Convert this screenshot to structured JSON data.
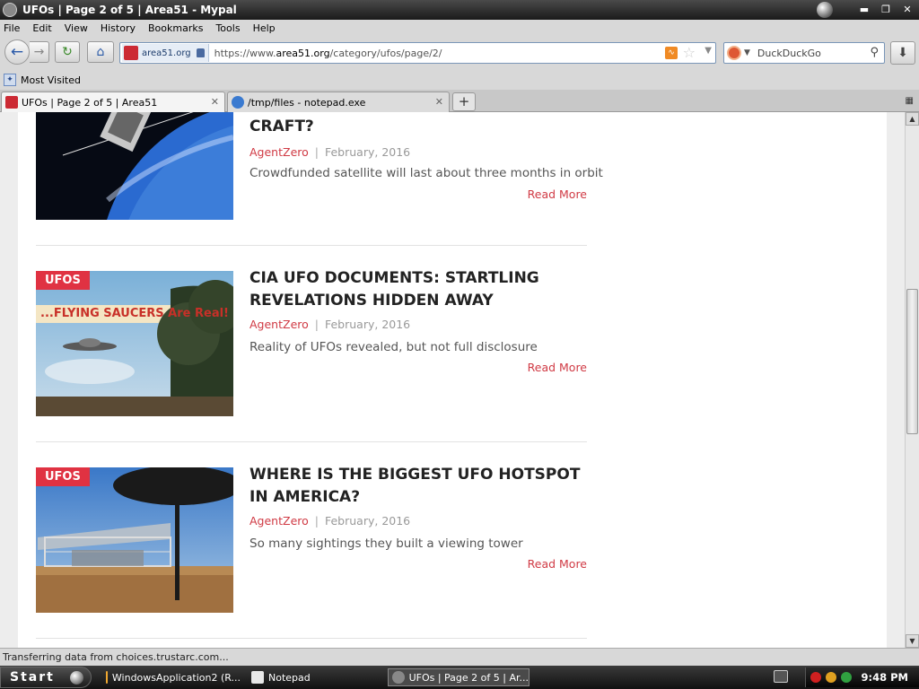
{
  "window": {
    "title": "UFOs | Page 2 of 5 | Area51 - Mypal"
  },
  "menu": [
    "File",
    "Edit",
    "View",
    "History",
    "Bookmarks",
    "Tools",
    "Help"
  ],
  "navbar": {
    "site_host": "area51.org",
    "url_prefix": "https://www.",
    "url_domain": "area51.org",
    "url_path": "/category/ufos/page/2/",
    "search_engine": "DuckDuckGo"
  },
  "bookmarks": {
    "most_visited": "Most Visited"
  },
  "tabs": [
    {
      "label": "UFOs | Page 2 of 5 | Area51",
      "active": true
    },
    {
      "label": "/tmp/files - notepad.exe",
      "active": false
    }
  ],
  "posts": [
    {
      "title": "CRAFT?",
      "author": "AgentZero",
      "date": "February, 2016",
      "excerpt": "Crowdfunded satellite will last about three months in orbit",
      "read_more": "Read More",
      "category": ""
    },
    {
      "title": "CIA UFO DOCUMENTS: STARTLING REVELATIONS HIDDEN AWAY",
      "author": "AgentZero",
      "date": "February, 2016",
      "excerpt": "Reality of UFOs revealed, but not full disclosure",
      "read_more": "Read More",
      "category": "UFOS",
      "banner_text": "...FLYING SAUCERS Are Real!"
    },
    {
      "title": "WHERE IS THE BIGGEST UFO HOTSPOT IN AMERICA?",
      "author": "AgentZero",
      "date": "February, 2016",
      "excerpt": "So many sightings they built a viewing tower",
      "read_more": "Read More",
      "category": "UFOS"
    }
  ],
  "meta_separator": "|",
  "status": {
    "text": "Transferring data from choices.trustarc.com..."
  },
  "taskbar": {
    "start": "Start",
    "tasks": [
      {
        "label": "WindowsApplication2 (R..."
      },
      {
        "label": "Notepad"
      },
      {
        "label": "UFOs | Page 2 of 5 | Ar..."
      }
    ],
    "clock": "9:48 PM"
  },
  "colors": {
    "accent": "#d03a44",
    "badge": "#e03242"
  }
}
